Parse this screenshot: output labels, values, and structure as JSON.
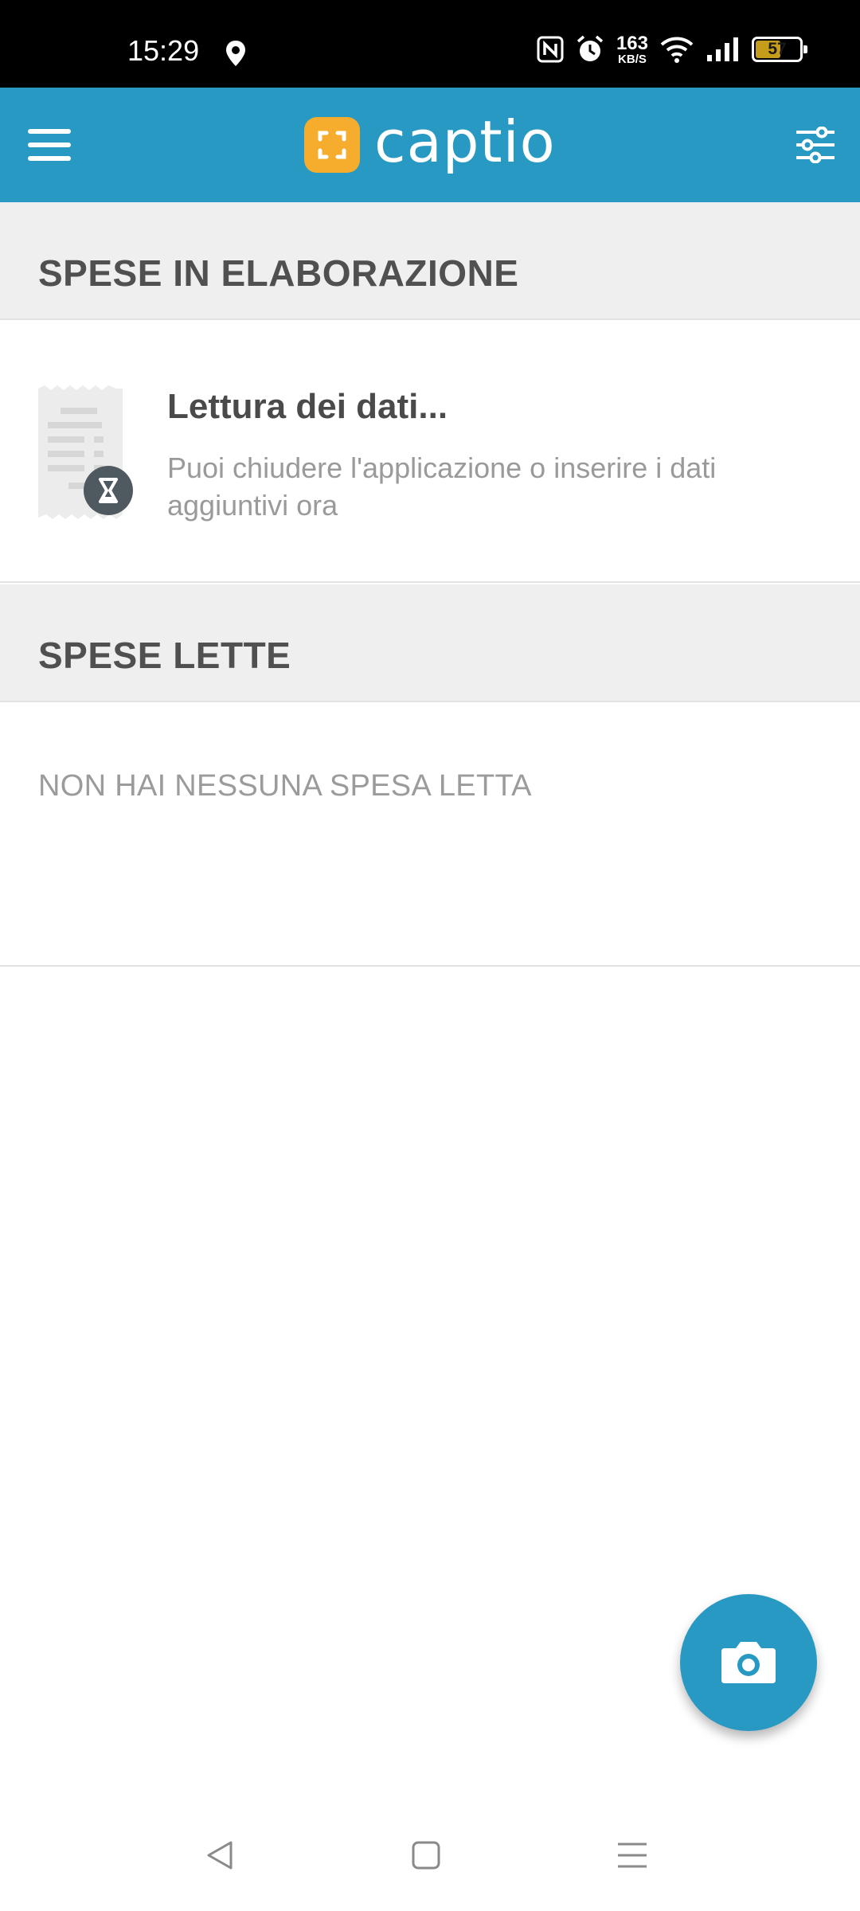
{
  "status_bar": {
    "time": "15:29",
    "speed_value": "163",
    "speed_unit": "KB/S",
    "battery": "57",
    "battery_level": 0.57,
    "icons": [
      "location-icon",
      "nfc-icon",
      "alarm-icon",
      "wifi-icon",
      "signal-icon",
      "battery-icon"
    ]
  },
  "app_bar": {
    "logo_text": "captio",
    "menu_icon": "hamburger-menu-icon",
    "filter_icon": "sliders-filter-icon",
    "color": "#2799c2",
    "logo_color": "#f6ad2e"
  },
  "sections": {
    "processing": {
      "title": "SPESE IN ELABORAZIONE",
      "item": {
        "title": "Lettura dei dati...",
        "subtitle": "Puoi chiudere l'applicazione o inserire i dati aggiuntivi ora",
        "icon": "receipt-hourglass-icon"
      }
    },
    "read": {
      "title": "SPESE LETTE",
      "empty_text": "NON HAI NESSUNA SPESA LETTA"
    }
  },
  "fab": {
    "icon": "camera-icon"
  },
  "nav_bar": {
    "icons": [
      "back-icon",
      "home-icon",
      "recents-icon"
    ]
  }
}
